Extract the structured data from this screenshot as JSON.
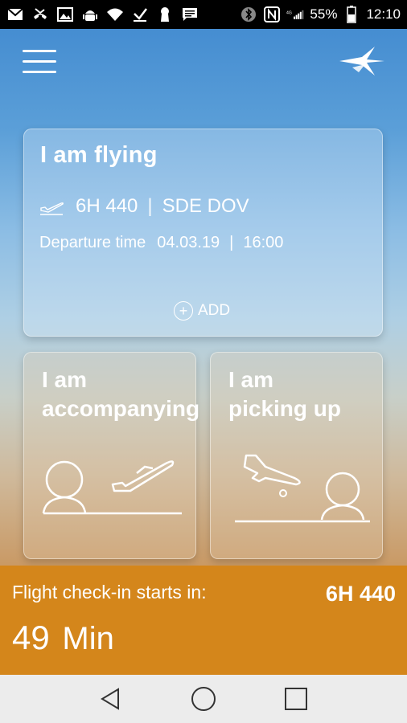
{
  "status_bar": {
    "battery": "55%",
    "time": "12:10",
    "left_icons": [
      "gmail-icon",
      "missed-call-icon",
      "image-icon",
      "android-icon",
      "wifi-icon",
      "download-icon",
      "keyhole-icon",
      "message-icon"
    ],
    "right_icons": [
      "bluetooth-icon",
      "nfc-icon",
      "signal-icon",
      "battery-icon"
    ]
  },
  "header": {
    "menu_icon": "menu-icon",
    "logo_icon": "airline-logo-icon"
  },
  "flying_card": {
    "title": "I am flying",
    "flight_number": "6H 440",
    "route": "SDE DOV",
    "departure_label": "Departure time",
    "departure_date": "04.03.19",
    "departure_time": "16:00",
    "add_label": "ADD"
  },
  "accompanying_card": {
    "title_line1": "I am",
    "title_line2": "accompanying"
  },
  "pickup_card": {
    "title_line1": "I am",
    "title_line2": "picking up"
  },
  "checkin": {
    "label": "Flight check-in starts in:",
    "flight_number": "6H 440",
    "value": "49",
    "unit": "Min"
  },
  "nav": {
    "back_icon": "back-triangle-icon",
    "home_icon": "home-circle-icon",
    "recents_icon": "recents-square-icon"
  },
  "colors": {
    "checkin_bar": "#d4861b",
    "sky_top": "#3f88cf",
    "desert_bottom": "#c98a48",
    "nav_bar": "#ececec"
  }
}
